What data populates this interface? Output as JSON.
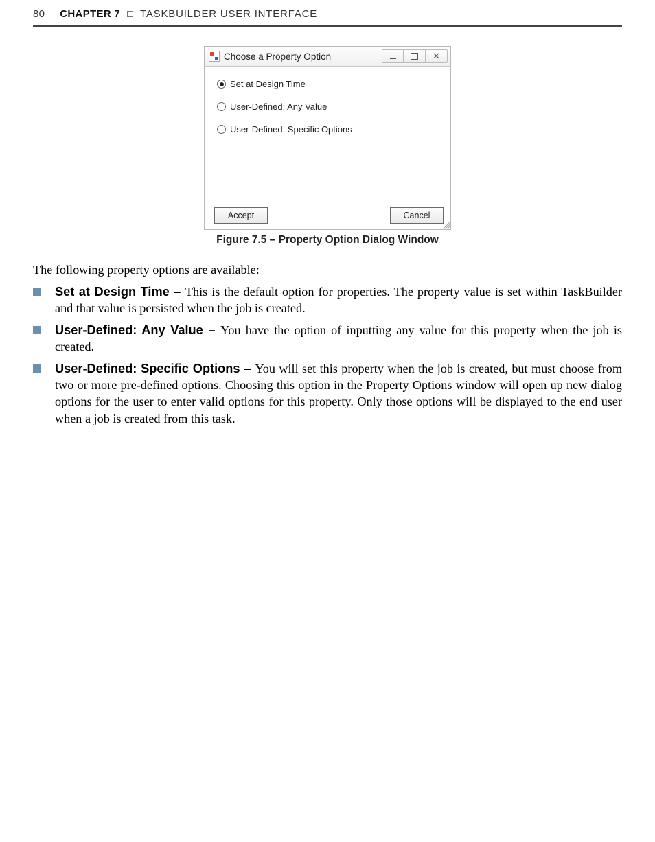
{
  "header": {
    "page_number": "80",
    "chapter_label": "CHAPTER 7",
    "title": "TASKBUILDER USER INTERFACE"
  },
  "dialog": {
    "title": "Choose a Property Option",
    "options": [
      {
        "label": "Set at Design Time",
        "selected": true
      },
      {
        "label": "User-Defined:  Any Value",
        "selected": false
      },
      {
        "label": "User-Defined:  Specific Options",
        "selected": false
      }
    ],
    "accept": "Accept",
    "cancel": "Cancel"
  },
  "figure_caption": "Figure 7.5 – Property Option Dialog Window",
  "intro": "The following property options are available:",
  "bullets": [
    {
      "title": "Set at Design Time – ",
      "text": "This is the default option for properties. The property value is set within TaskBuilder and that value is persisted when the job is created."
    },
    {
      "title": "User-Defined: Any Value – ",
      "text": "You have the option of inputting any value for this property when the job is created."
    },
    {
      "title": "User-Defined: Specific Options – ",
      "text": "You will set this property when the job is created, but must choose from two or more pre-defined options. Choosing this option in the Property Options window will open up new dialog options for the user to enter valid options for this property. Only those options will be displayed to the end user when a job is created from this task."
    }
  ]
}
